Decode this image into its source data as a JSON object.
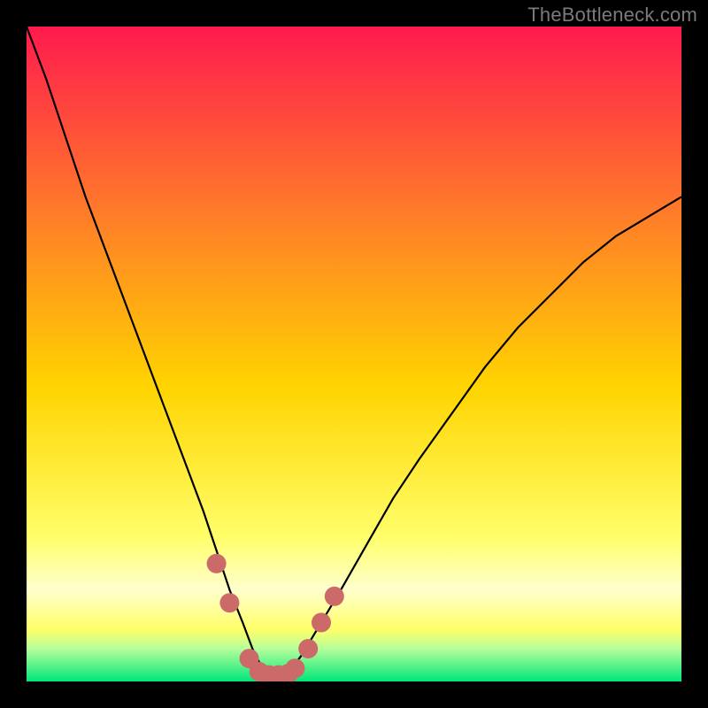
{
  "watermark": "TheBottleneck.com",
  "colors": {
    "gradient_top": "#ff1a4e",
    "gradient_mid1": "#ff7a2a",
    "gradient_mid2": "#ffd400",
    "gradient_mid3": "#ffff6a",
    "gradient_band": "#ffffce",
    "gradient_green1": "#b6ff9a",
    "gradient_green2": "#00e77a",
    "curve": "#000000",
    "dots": "#cc6a6a"
  },
  "chart_data": {
    "type": "line",
    "title": "",
    "xlabel": "",
    "ylabel": "",
    "xlim": [
      0,
      100
    ],
    "ylim": [
      0,
      100
    ],
    "series": [
      {
        "name": "bottleneck-curve",
        "x": [
          0,
          3,
          6,
          9,
          12,
          15,
          18,
          21,
          24,
          27,
          29,
          31,
          33,
          34.5,
          36,
          37.5,
          39,
          40.5,
          42,
          45,
          48,
          52,
          56,
          60,
          65,
          70,
          75,
          80,
          85,
          90,
          95,
          100
        ],
        "y": [
          100,
          92,
          83,
          74,
          66,
          58,
          50,
          42,
          34,
          26,
          20,
          14,
          9,
          5,
          2,
          0.5,
          0.5,
          2,
          4,
          9,
          14,
          21,
          28,
          34,
          41,
          48,
          54,
          59,
          64,
          68,
          71,
          74
        ]
      }
    ],
    "markers": {
      "name": "valley-dots",
      "x": [
        29,
        31,
        34,
        35.5,
        37,
        38.5,
        40,
        41,
        43,
        45,
        47
      ],
      "y": [
        18,
        12,
        3.5,
        1.5,
        1,
        1,
        1.2,
        2,
        5,
        9,
        13
      ]
    }
  }
}
